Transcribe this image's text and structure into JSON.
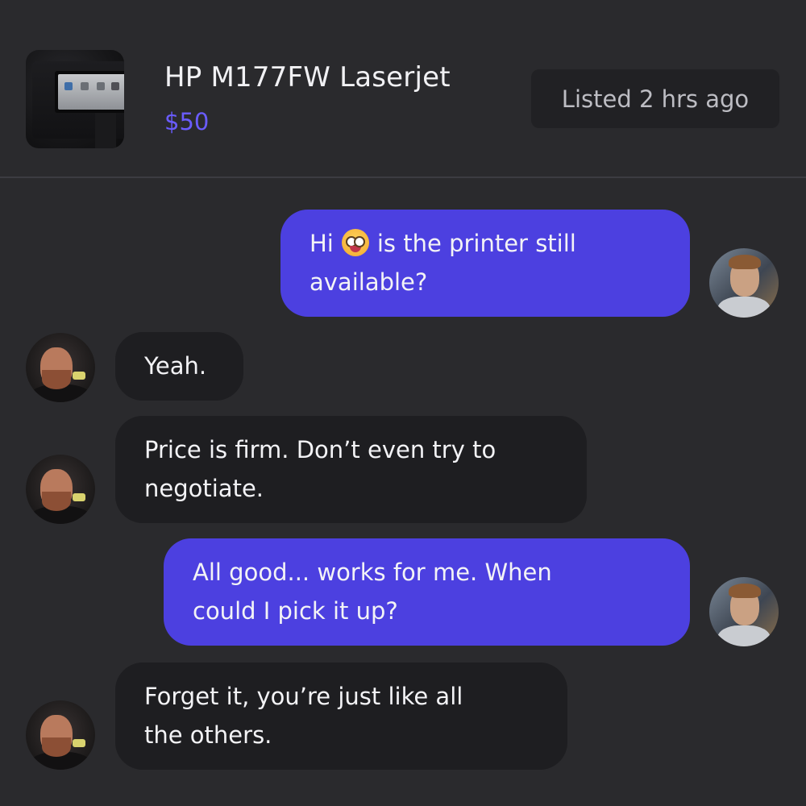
{
  "header": {
    "title": "HP M177FW Laserjet",
    "price": "$50",
    "listed": "Listed 2 hrs ago",
    "thumbnail_icon": "printer-thumbnail"
  },
  "colors": {
    "accent": "#4c40e0",
    "price": "#6a5cff",
    "background": "#2a2a2d",
    "incoming_bubble": "#1e1e21"
  },
  "messages": [
    {
      "sender": "me",
      "line1_pre": "Hi",
      "line1_post": "is the printer still",
      "line2": "available?",
      "emoji": "grinning-face-emoji"
    },
    {
      "sender": "them",
      "line1": "Yeah."
    },
    {
      "sender": "them",
      "line1": "Price is firm. Don’t even try to",
      "line2": "negotiate."
    },
    {
      "sender": "me",
      "line1": "All good... works for me. When",
      "line2": "could I pick it up?"
    },
    {
      "sender": "them",
      "line1": "Forget it, you’re just like all",
      "line2": "the others."
    }
  ]
}
